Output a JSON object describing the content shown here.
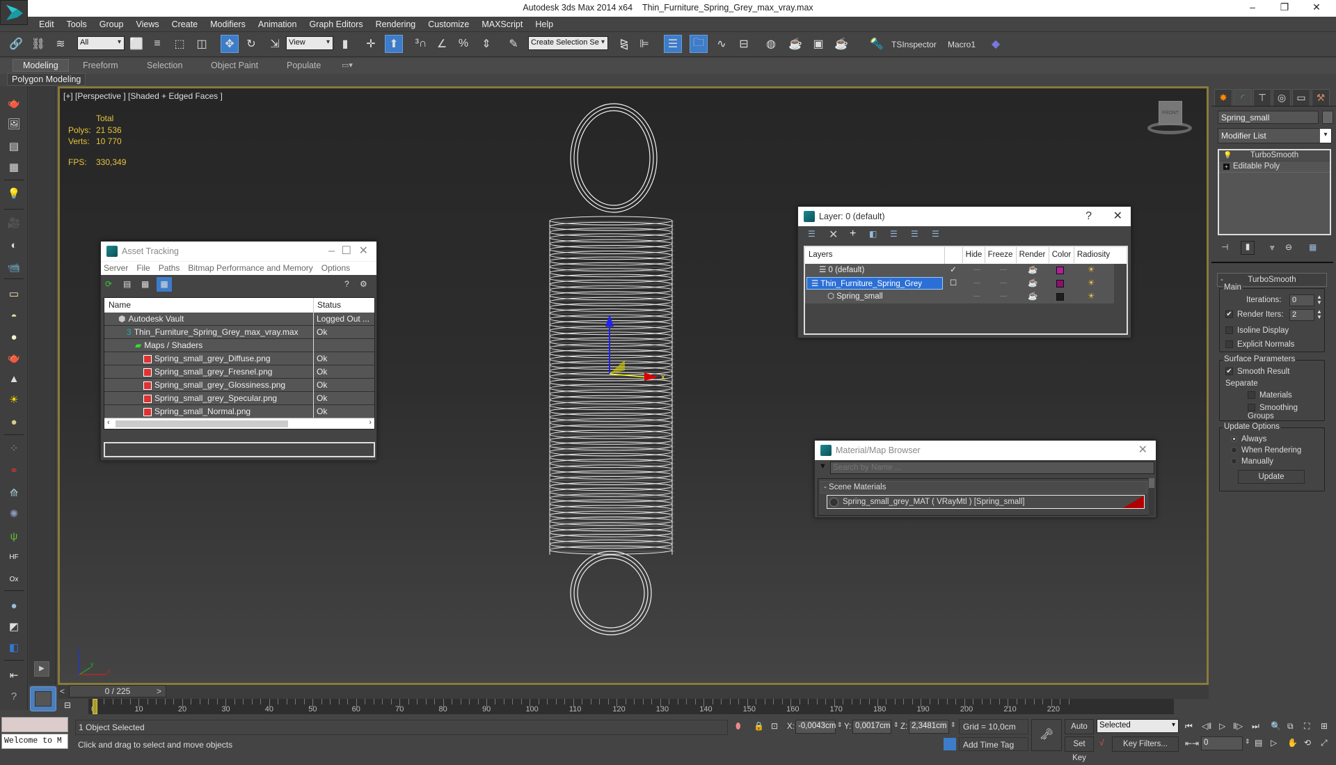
{
  "window": {
    "app_title": "Autodesk 3ds Max  2014 x64",
    "file_title": "Thin_Furniture_Spring_Grey_max_vray.max",
    "controls": {
      "minimize": "–",
      "restore": "❐",
      "close": "✕"
    }
  },
  "menu": [
    "Edit",
    "Tools",
    "Group",
    "Views",
    "Create",
    "Modifiers",
    "Animation",
    "Graph Editors",
    "Rendering",
    "Customize",
    "MAXScript",
    "Help"
  ],
  "toolbar": {
    "selection_filter": "All",
    "ref_coord": "View",
    "named_selection_placeholder": "Create Selection Se",
    "tsinspector_label": "TSInspector",
    "macro_label": "Macro1",
    "icons": [
      "link-icon",
      "unlink-icon",
      "bind-space-warp-icon",
      "select-object-icon",
      "select-by-name-icon",
      "rect-selection-icon",
      "window-crossing-icon",
      "select-move-icon",
      "select-rotate-icon",
      "select-scale-icon",
      "use-pivot-icon",
      "select-manipulate-icon",
      "snap-3d-icon",
      "angle-snap-icon",
      "percent-snap-icon",
      "spinner-snap-icon",
      "edit-named-sets-icon",
      "mirror-icon",
      "align-icon",
      "layer-explorer-icon",
      "scene-explorer-icon",
      "curve-editor-icon",
      "schematic-view-icon",
      "material-editor-icon",
      "render-setup-icon",
      "render-frame-icon",
      "render-icon"
    ]
  },
  "ribbon": {
    "tabs": [
      "Modeling",
      "Freeform",
      "Selection",
      "Object Paint",
      "Populate"
    ],
    "active_tab": "Modeling",
    "panel_label": "Polygon Modeling"
  },
  "viewport": {
    "label": "[+] [Perspective ] [Shaded + Edged Faces ]",
    "stats": {
      "header": "Total",
      "polys_label": "Polys:",
      "polys": "21 536",
      "verts_label": "Verts:",
      "verts": "10 770",
      "fps_label": "FPS:",
      "fps": "330,349"
    },
    "viewcube_label": "FRONT",
    "gizmo_axis_x": "x",
    "axis_labels": {
      "x": "x",
      "y": "y",
      "z": "z"
    }
  },
  "asset_tracking": {
    "title": "Asset Tracking",
    "menu": [
      "Server",
      "File",
      "Paths",
      "Bitmap Performance and Memory",
      "Options"
    ],
    "columns": [
      "Name",
      "Status"
    ],
    "rows": [
      {
        "name": "Autodesk Vault",
        "status": "Logged Out ...",
        "indent": 1,
        "icon": "vault-icon"
      },
      {
        "name": "Thin_Furniture_Spring_Grey_max_vray.max",
        "status": "Ok",
        "indent": 2,
        "icon": "max-file-icon"
      },
      {
        "name": "Maps / Shaders",
        "status": "",
        "indent": 3,
        "icon": "maps-icon"
      },
      {
        "name": "Spring_small_grey_Diffuse.png",
        "status": "Ok",
        "indent": 4,
        "icon": "png-icon"
      },
      {
        "name": "Spring_small_grey_Fresnel.png",
        "status": "Ok",
        "indent": 4,
        "icon": "png-icon"
      },
      {
        "name": "Spring_small_grey_Glossiness.png",
        "status": "Ok",
        "indent": 4,
        "icon": "png-icon"
      },
      {
        "name": "Spring_small_grey_Specular.png",
        "status": "Ok",
        "indent": 4,
        "icon": "png-icon"
      },
      {
        "name": "Spring_small_Normal.png",
        "status": "Ok",
        "indent": 4,
        "icon": "png-icon"
      }
    ]
  },
  "layer_dialog": {
    "title": "Layer: 0 (default)",
    "help": "?",
    "columns": [
      "Layers",
      "",
      "Hide",
      "Freeze",
      "Render",
      "Color",
      "Radiosity"
    ],
    "rows": [
      {
        "name": "0 (default)",
        "current": "✓",
        "color": "#b0209c",
        "selected": false,
        "indent": 1
      },
      {
        "name": "Thin_Furniture_Spring_Grey",
        "current": "☐",
        "color": "#8a1070",
        "selected": true,
        "indent": 0
      },
      {
        "name": "Spring_small",
        "current": "",
        "color": "#1e1e1e",
        "selected": false,
        "indent": 2
      }
    ]
  },
  "material_browser": {
    "title": "Material/Map Browser",
    "search_placeholder": "Search by Name ...",
    "group": "- Scene Materials",
    "items": [
      "Spring_small_grey_MAT  ( VRayMtl )  [Spring_small]"
    ],
    "accent": "#b00000"
  },
  "command_panel": {
    "object_name": "Spring_small",
    "modifier_list": "Modifier List",
    "stack": [
      "TurboSmooth",
      "Editable Poly"
    ],
    "rollout_title": "TurboSmooth",
    "main_group": "Main",
    "iterations_label": "Iterations:",
    "iterations": "0",
    "render_iters_label": "Render Iters:",
    "render_iters": "2",
    "render_iters_checked": true,
    "isoline_label": "Isoline Display",
    "explicit_normals_label": "Explicit Normals",
    "surface_group": "Surface Parameters",
    "smooth_result_label": "Smooth Result",
    "separate_label": "Separate",
    "materials_label": "Materials",
    "smoothing_groups_label": "Smoothing Groups",
    "update_group": "Update Options",
    "update_options": [
      "Always",
      "When Rendering",
      "Manually"
    ],
    "update_selected": "Always",
    "update_button": "Update"
  },
  "timeline": {
    "frame_display": "0 / 225",
    "prev": "<",
    "next": ">",
    "current_frame": 0,
    "total_frames": 225,
    "tick_labels": [
      "0",
      "10",
      "20",
      "30",
      "40",
      "50",
      "60",
      "70",
      "80",
      "90",
      "100",
      "110",
      "120",
      "130",
      "140",
      "150",
      "160",
      "170",
      "180",
      "190",
      "200",
      "210",
      "220"
    ]
  },
  "status_bar": {
    "maxscript_listener": "Welcome to M",
    "selection_status": "1 Object Selected",
    "prompt": "Click and drag to select and move objects",
    "x_label": "X:",
    "x": "-0,0043cm",
    "y_label": "Y:",
    "y": "0,0017cm",
    "z_label": "Z:",
    "z": "2,3481cm",
    "grid": "Grid = 10,0cm",
    "add_time_tag": "Add Time Tag",
    "auto_key": "Auto Key",
    "set_key": "Set Key",
    "key_mode": "Selected",
    "key_filters": "Key Filters...",
    "frame_field": "0"
  }
}
